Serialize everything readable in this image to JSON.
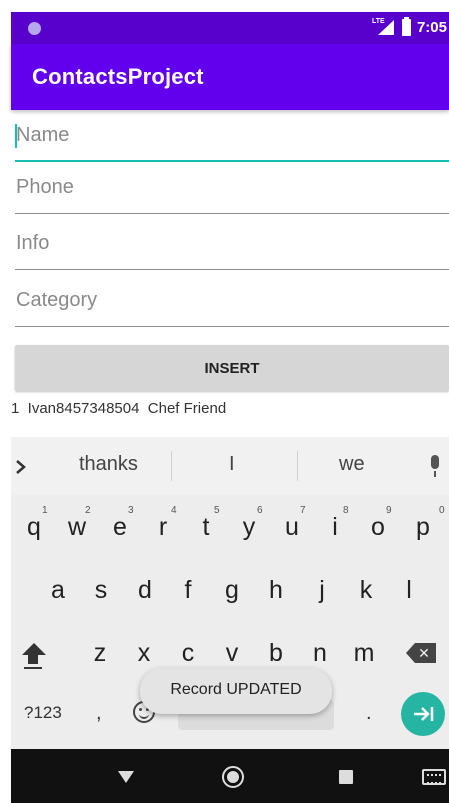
{
  "status_bar": {
    "network": "LTE",
    "time": "7:05"
  },
  "app_bar": {
    "title": "ContactsProject"
  },
  "form": {
    "name_placeholder": "Name",
    "phone_placeholder": "Phone",
    "info_placeholder": "Info",
    "category_placeholder": "Category",
    "insert_label": "INSERT"
  },
  "records": [
    {
      "text": "1  Ivan8457348504  Chef Friend"
    }
  ],
  "keyboard": {
    "suggestions": [
      "thanks",
      "I",
      "we"
    ],
    "row1": [
      {
        "key": "q",
        "hint": "1"
      },
      {
        "key": "w",
        "hint": "2"
      },
      {
        "key": "e",
        "hint": "3"
      },
      {
        "key": "r",
        "hint": "4"
      },
      {
        "key": "t",
        "hint": "5"
      },
      {
        "key": "y",
        "hint": "6"
      },
      {
        "key": "u",
        "hint": "7"
      },
      {
        "key": "i",
        "hint": "8"
      },
      {
        "key": "o",
        "hint": "9"
      },
      {
        "key": "p",
        "hint": "0"
      }
    ],
    "row2": [
      "a",
      "s",
      "d",
      "f",
      "g",
      "h",
      "j",
      "k",
      "l"
    ],
    "row3": [
      "z",
      "x",
      "c",
      "v",
      "b",
      "n",
      "m"
    ],
    "symbols_label": "?123",
    "comma_label": ",",
    "period_label": "."
  },
  "toast": {
    "message": "Record UPDATED"
  },
  "icons": {
    "accent": "#6200ee",
    "status_bar_color": "#5800cc",
    "focus_color": "#17bdb3",
    "enter_color": "#26b5a3"
  }
}
